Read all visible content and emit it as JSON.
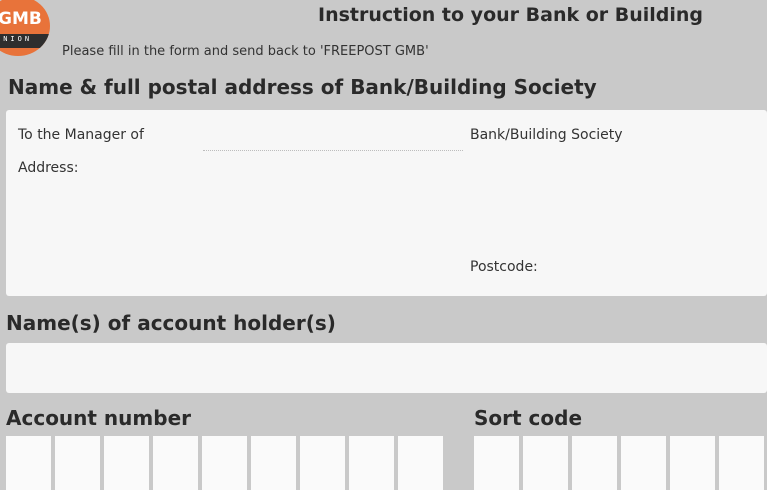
{
  "logo": {
    "name": "GMB",
    "sub": "UNION"
  },
  "header": {
    "title": "Instruction to your Bank or Building",
    "instruction": "Please fill in the form and send back to 'FREEPOST GMB'"
  },
  "bank_section": {
    "heading": "Name & full postal address of Bank/Building Society",
    "to_manager_label": "To the Manager of",
    "bank_building_label": "Bank/Building Society",
    "address_label": "Address:",
    "postcode_label": "Postcode:"
  },
  "holder_section": {
    "heading": "Name(s) of account holder(s)"
  },
  "account_section": {
    "heading": "Account number",
    "box_count": 9
  },
  "sort_section": {
    "heading": "Sort code",
    "box_count": 6
  }
}
